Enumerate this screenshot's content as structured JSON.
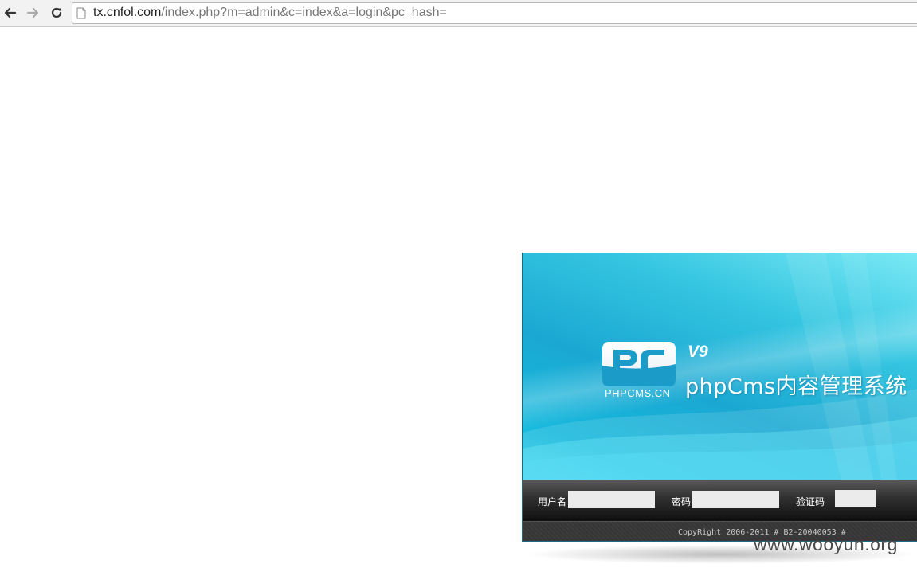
{
  "browser": {
    "url_host": "tx.cnfol.com",
    "url_path": "/index.php?m=admin&c=index&a=login&pc_hash=",
    "icons": [
      "back-arrow-icon",
      "forward-arrow-icon",
      "reload-icon",
      "page-icon"
    ]
  },
  "login": {
    "logo_caption": "PHPCMS.CN",
    "version": "V9",
    "system_title": "phpCms内容管理系统",
    "username_label": "用户名",
    "password_label": "密码",
    "captcha_label": "验证码",
    "username_value": "",
    "password_value": "",
    "captcha_value": "",
    "copyright": "CopyRight 2006-2011 # B2-20040053 #"
  },
  "watermark": "www.wooyun.org",
  "colors": {
    "banner": "#1aa8d2",
    "form_bar": "#1a1a1a",
    "input_bg": "#ebebeb"
  }
}
